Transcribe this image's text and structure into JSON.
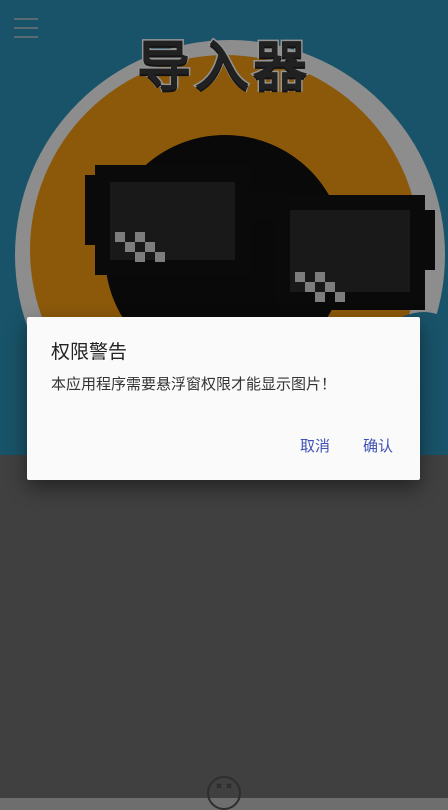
{
  "app": {
    "title": "导入器"
  },
  "dialog": {
    "title": "权限警告",
    "message": "本应用程序需要悬浮窗权限才能显示图片！",
    "cancel_label": "取消",
    "confirm_label": "确认"
  },
  "colors": {
    "accent": "#3f51b5",
    "hero_background": "#2b8fb6",
    "hero_ring": "#f29a12",
    "scrim": "#6e6e6e"
  },
  "icons": {
    "menu": "hamburger-menu-icon",
    "hero": "pixel-sunglasses-icon",
    "fab": "face-icon"
  }
}
